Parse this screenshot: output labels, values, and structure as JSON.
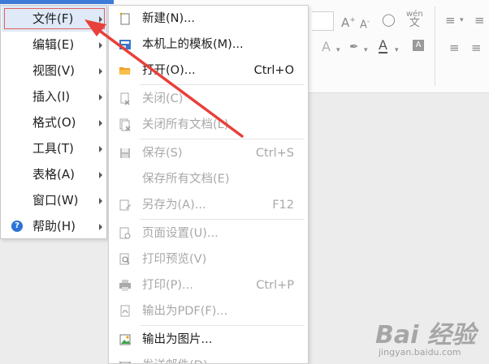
{
  "main_menu": {
    "items": [
      {
        "label": "文件(F)",
        "active": true
      },
      {
        "label": "编辑(E)"
      },
      {
        "label": "视图(V)"
      },
      {
        "label": "插入(I)"
      },
      {
        "label": "格式(O)"
      },
      {
        "label": "工具(T)"
      },
      {
        "label": "表格(A)"
      },
      {
        "label": "窗口(W)"
      },
      {
        "label": "帮助(H)",
        "icon": "help-icon"
      }
    ]
  },
  "sub_menu": {
    "items": [
      {
        "label": "新建(N)...",
        "shortcut": "",
        "icon": "new-document-icon",
        "enabled": true
      },
      {
        "label": "本机上的模板(M)...",
        "shortcut": "",
        "icon": "template-icon",
        "enabled": true
      },
      {
        "label": "打开(O)...",
        "shortcut": "Ctrl+O",
        "icon": "folder-open-icon",
        "enabled": true
      },
      {
        "label": "关闭(C)",
        "shortcut": "",
        "icon": "close-document-icon",
        "enabled": false
      },
      {
        "label": "关闭所有文档(L)",
        "shortcut": "",
        "icon": "close-all-documents-icon",
        "enabled": false
      },
      {
        "label": "保存(S)",
        "shortcut": "Ctrl+S",
        "icon": "save-icon",
        "enabled": false
      },
      {
        "label": "保存所有文档(E)",
        "shortcut": "",
        "icon": "",
        "enabled": false
      },
      {
        "label": "另存为(A)...",
        "shortcut": "F12",
        "icon": "save-as-icon",
        "enabled": false
      },
      {
        "label": "页面设置(U)...",
        "shortcut": "",
        "icon": "page-setup-icon",
        "enabled": false
      },
      {
        "label": "打印预览(V)",
        "shortcut": "",
        "icon": "print-preview-icon",
        "enabled": false
      },
      {
        "label": "打印(P)...",
        "shortcut": "Ctrl+P",
        "icon": "printer-icon",
        "enabled": false
      },
      {
        "label": "输出为PDF(F)...",
        "shortcut": "",
        "icon": "export-pdf-icon",
        "enabled": false
      },
      {
        "label": "输出为图片...",
        "shortcut": "",
        "icon": "export-image-icon",
        "enabled": true
      },
      {
        "label": "发送邮件(D)...",
        "shortcut": "",
        "icon": "send-mail-icon",
        "enabled": false
      }
    ]
  },
  "ribbon": {
    "icons": [
      "font-grow-icon",
      "font-shrink-icon",
      "clear-format-icon",
      "phonetic-guide-icon",
      "bullet-list-icon",
      "text-effect-icon",
      "highlight-icon",
      "font-color-icon",
      "char-shading-icon",
      "align-left-icon",
      "align-center-icon"
    ],
    "phonetic_label": "wén",
    "phonetic_char": "文",
    "font_color_letter": "A",
    "shading_letter": "A",
    "effect_letter": "A",
    "grow_letter": "A",
    "shrink_letter": "A"
  },
  "colors": {
    "accent": "#3e7bd8",
    "arrow": "#e8403a",
    "menu_active_bg": "#dfe9f7",
    "disabled_text": "#a8a8a8"
  },
  "watermark": {
    "text": "Bai 经验",
    "url": "jingyan.baidu.com"
  }
}
